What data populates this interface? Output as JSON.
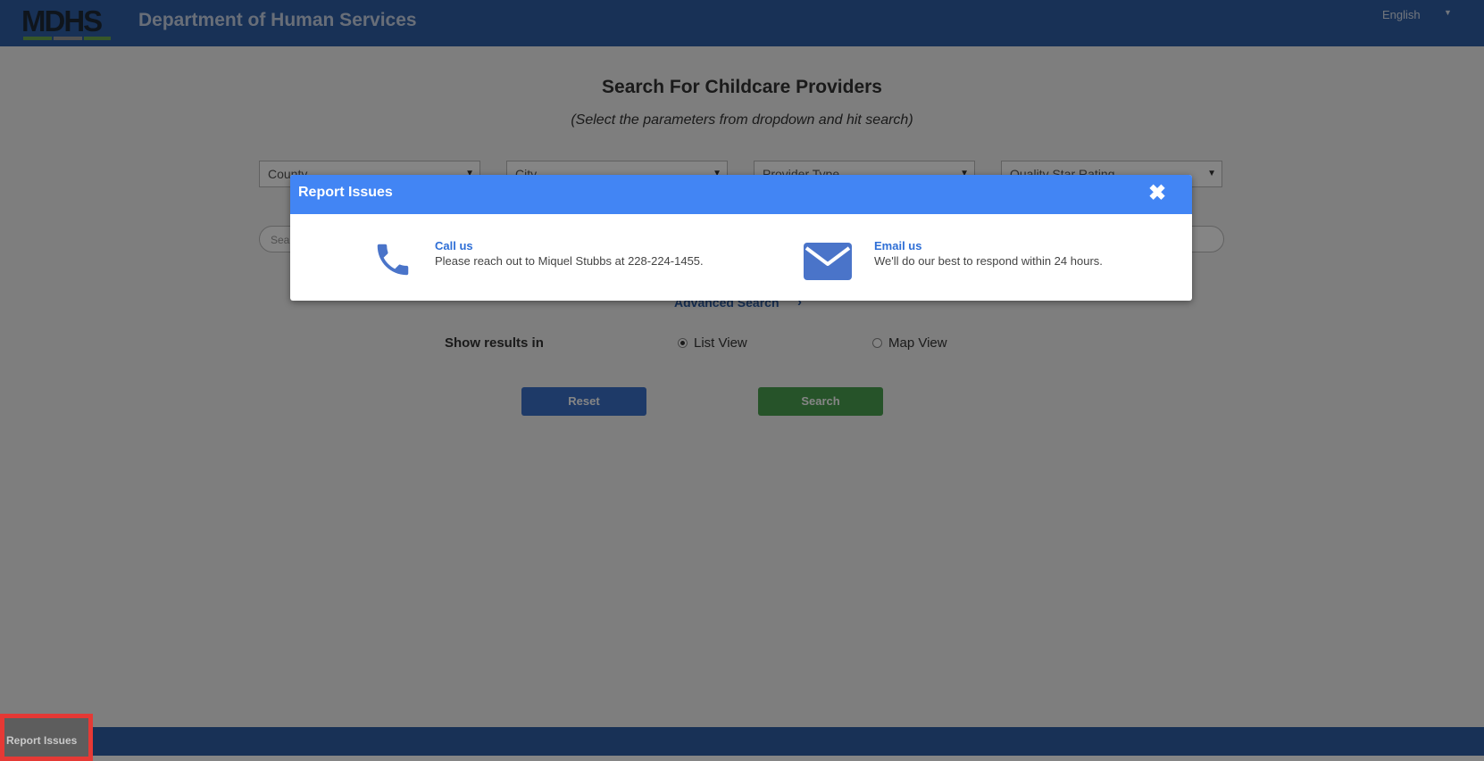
{
  "header": {
    "logo_text": "MDHS",
    "title": "Department of Human Services",
    "language": "English"
  },
  "search": {
    "title": "Search For Childcare Providers",
    "subtitle": "(Select the parameters from dropdown and hit search)",
    "dropdowns": [
      "County",
      "City",
      "Provider Type",
      "Quality Star Rating"
    ],
    "keyword_placeholder": "Sea",
    "advanced_label": "Advanced Search",
    "show_results_label": "Show results in",
    "views": [
      {
        "label": "List View",
        "selected": true
      },
      {
        "label": "Map View",
        "selected": false
      }
    ],
    "reset_label": "Reset",
    "search_label": "Search"
  },
  "modal": {
    "title": "Report Issues",
    "call": {
      "title": "Call us",
      "text": "Please reach out to Miquel Stubbs at 228-224-1455."
    },
    "email": {
      "title": "Email us",
      "text": "We'll do our best to respond within 24 hours."
    }
  },
  "footer": {
    "report_tab_label": "Report Issues"
  },
  "colors": {
    "header_blue": "#2f5ea6",
    "modal_header": "#4285f4",
    "reset_button": "#3a6fc7",
    "search_button": "#4a9f4f",
    "highlight_border": "#e53935"
  }
}
